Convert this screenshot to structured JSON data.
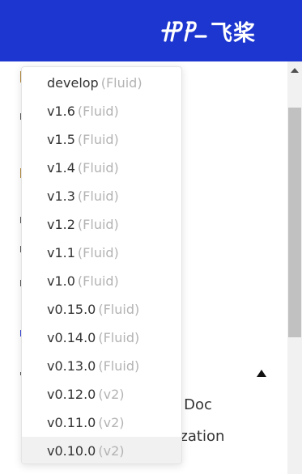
{
  "header": {
    "brand_text": "飞桨",
    "logo_icon": "paddlepaddle-logo-icon",
    "background_color": "#1c36cf"
  },
  "background_page": {
    "items": [
      {
        "label": "n Doc"
      },
      {
        "label": "rization"
      }
    ]
  },
  "version_menu": {
    "selected_index": 13,
    "items": [
      {
        "version": "develop",
        "tag": "(Fluid)"
      },
      {
        "version": "v1.6",
        "tag": "(Fluid)"
      },
      {
        "version": "v1.5",
        "tag": "(Fluid)"
      },
      {
        "version": "v1.4",
        "tag": "(Fluid)"
      },
      {
        "version": "v1.3",
        "tag": "(Fluid)"
      },
      {
        "version": "v1.2",
        "tag": "(Fluid)"
      },
      {
        "version": "v1.1",
        "tag": "(Fluid)"
      },
      {
        "version": "v1.0",
        "tag": "(Fluid)"
      },
      {
        "version": "v0.15.0",
        "tag": "(Fluid)"
      },
      {
        "version": "v0.14.0",
        "tag": "(Fluid)"
      },
      {
        "version": "v0.13.0",
        "tag": "(Fluid)"
      },
      {
        "version": "v0.12.0",
        "tag": "(v2)"
      },
      {
        "version": "v0.11.0",
        "tag": "(v2)"
      },
      {
        "version": "v0.10.0",
        "tag": "(v2)"
      }
    ]
  }
}
